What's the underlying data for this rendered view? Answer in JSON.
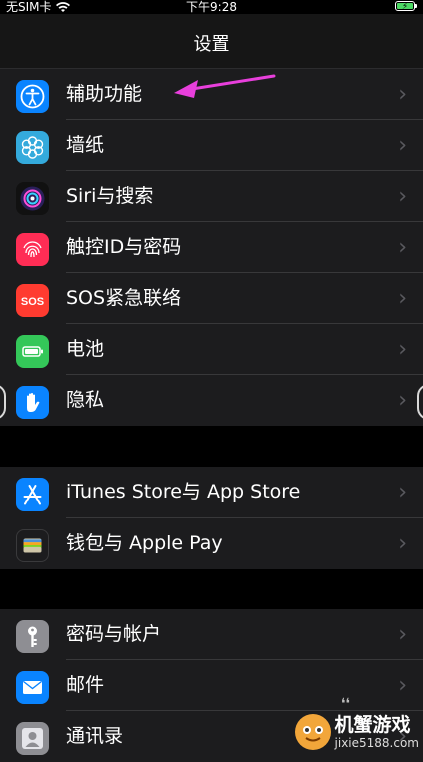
{
  "status_bar": {
    "carrier": "无SIM卡",
    "time": "下午9:28"
  },
  "nav": {
    "title": "设置"
  },
  "groups": [
    {
      "items": [
        {
          "label": "辅助功能",
          "icon": "accessibility-icon",
          "color": "#0a84ff"
        },
        {
          "label": "墙纸",
          "icon": "wallpaper-icon",
          "color": "#34aadc"
        },
        {
          "label": "Siri与搜索",
          "icon": "siri-icon",
          "color": "#111111"
        },
        {
          "label": "触控ID与密码",
          "icon": "fingerprint-icon",
          "color": "#ff2d55"
        },
        {
          "label": "SOS紧急联络",
          "icon": "sos-icon",
          "color": "#ff3b30"
        },
        {
          "label": "电池",
          "icon": "battery-icon",
          "color": "#34c759"
        },
        {
          "label": "隐私",
          "icon": "hand-icon",
          "color": "#0a84ff"
        }
      ]
    },
    {
      "items": [
        {
          "label": "iTunes Store与 App Store",
          "icon": "app-store-icon",
          "color": "#0a84ff"
        },
        {
          "label": "钱包与 Apple Pay",
          "icon": "wallet-icon",
          "color": "#1c1c1e"
        }
      ]
    },
    {
      "items": [
        {
          "label": "密码与帐户",
          "icon": "key-icon",
          "color": "#8e8e93"
        },
        {
          "label": "邮件",
          "icon": "mail-icon",
          "color": "#0a84ff"
        },
        {
          "label": "通讯录",
          "icon": "contacts-icon",
          "color": "#8e8e93"
        }
      ]
    }
  ],
  "watermark": {
    "title": "机蟹游戏",
    "url": "jixie5188.com"
  },
  "colors": {
    "background": "#000000",
    "cell": "#1c1c1e",
    "separator": "#38383a",
    "annotation_arrow": "#e83fdc"
  }
}
